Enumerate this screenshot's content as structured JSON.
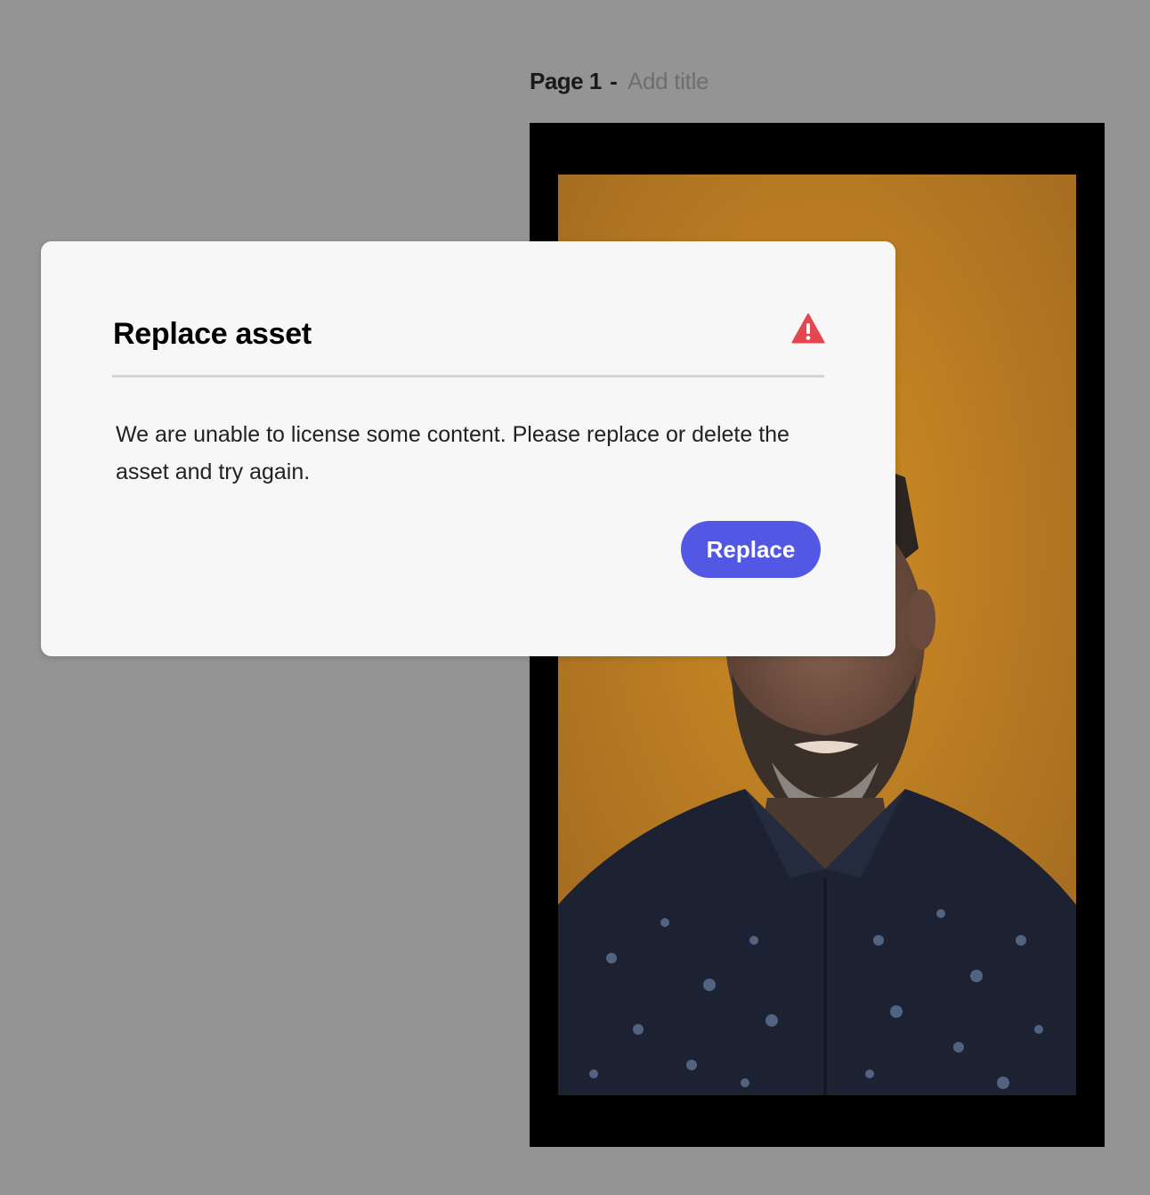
{
  "page": {
    "label": "Page 1",
    "separator": "-",
    "title_placeholder": "Add title"
  },
  "canvas": {
    "content": "video-frame-person"
  },
  "dialog": {
    "title": "Replace asset",
    "icon": "alert-triangle-icon",
    "message": "We are unable to license some content. Please replace or delete the asset and try again.",
    "replace_label": "Replace"
  },
  "colors": {
    "background": "#949494",
    "dialog_bg": "#f7f7f7",
    "accent": "#5258e4",
    "alert": "#e34850",
    "video_bg": "#c4821e"
  }
}
